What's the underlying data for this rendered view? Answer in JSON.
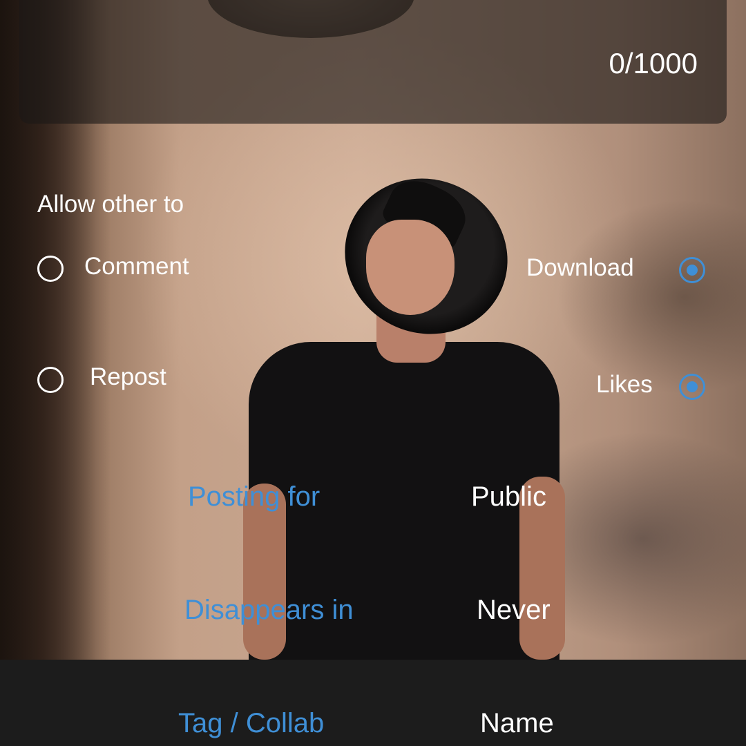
{
  "caption": {
    "counter": "0/1000"
  },
  "permissions": {
    "heading": "Allow other to",
    "options": [
      {
        "label": "Comment",
        "selected": false
      },
      {
        "label": "Download",
        "selected": true
      },
      {
        "label": "Repost",
        "selected": false
      },
      {
        "label": "Likes",
        "selected": true
      }
    ]
  },
  "settings": {
    "posting_for_label": "Posting for",
    "posting_for_value": "Public",
    "disappears_label": "Disappears in",
    "disappears_value": "Never"
  },
  "bottom": {
    "tag_label": "Tag / Collab",
    "tag_value": "Name"
  },
  "colors": {
    "accent": "#3f8fd6",
    "text": "#ffffff",
    "bar": "#1c1c1c"
  }
}
